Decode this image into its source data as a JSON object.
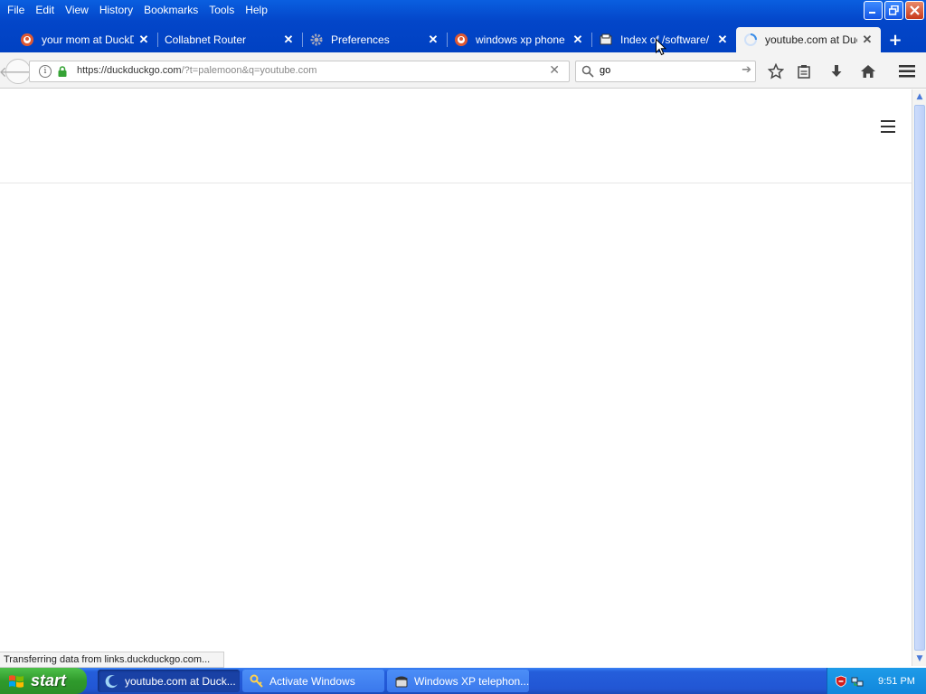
{
  "menu": {
    "items": [
      "File",
      "Edit",
      "View",
      "History",
      "Bookmarks",
      "Tools",
      "Help"
    ]
  },
  "tabs": [
    {
      "title": "your mom at DuckDu",
      "icon": "duckduckgo-icon",
      "active": false
    },
    {
      "title": "Collabnet Router",
      "icon": "none",
      "active": false
    },
    {
      "title": "Preferences",
      "icon": "gear-icon",
      "active": false
    },
    {
      "title": "windows xp phone k",
      "icon": "duckduckgo-icon",
      "active": false
    },
    {
      "title": "Index of /software/",
      "icon": "folder-icon",
      "active": false
    },
    {
      "title": "youtube.com at Duc",
      "icon": "loading-icon",
      "active": true
    }
  ],
  "navbar": {
    "url_host": "https://duckduckgo.com",
    "url_path": "/?t=palemoon&q=youtube.com",
    "search_value": "go"
  },
  "status": {
    "text": "Transferring data from links.duckduckgo.com..."
  },
  "taskbar": {
    "start_label": "start",
    "tasks": [
      {
        "label": "youtube.com at Duck...",
        "icon": "palemoon-icon",
        "active": true
      },
      {
        "label": "Activate Windows",
        "icon": "keys-icon",
        "active": false
      },
      {
        "label": "Windows XP telephon...",
        "icon": "phone-icon",
        "active": false
      }
    ],
    "clock": "9:51 PM"
  },
  "colors": {
    "titlebar": "#0346c9",
    "taskbar": "#245edb",
    "start_button": "#2f9a2c",
    "tray": "#1187dc"
  }
}
